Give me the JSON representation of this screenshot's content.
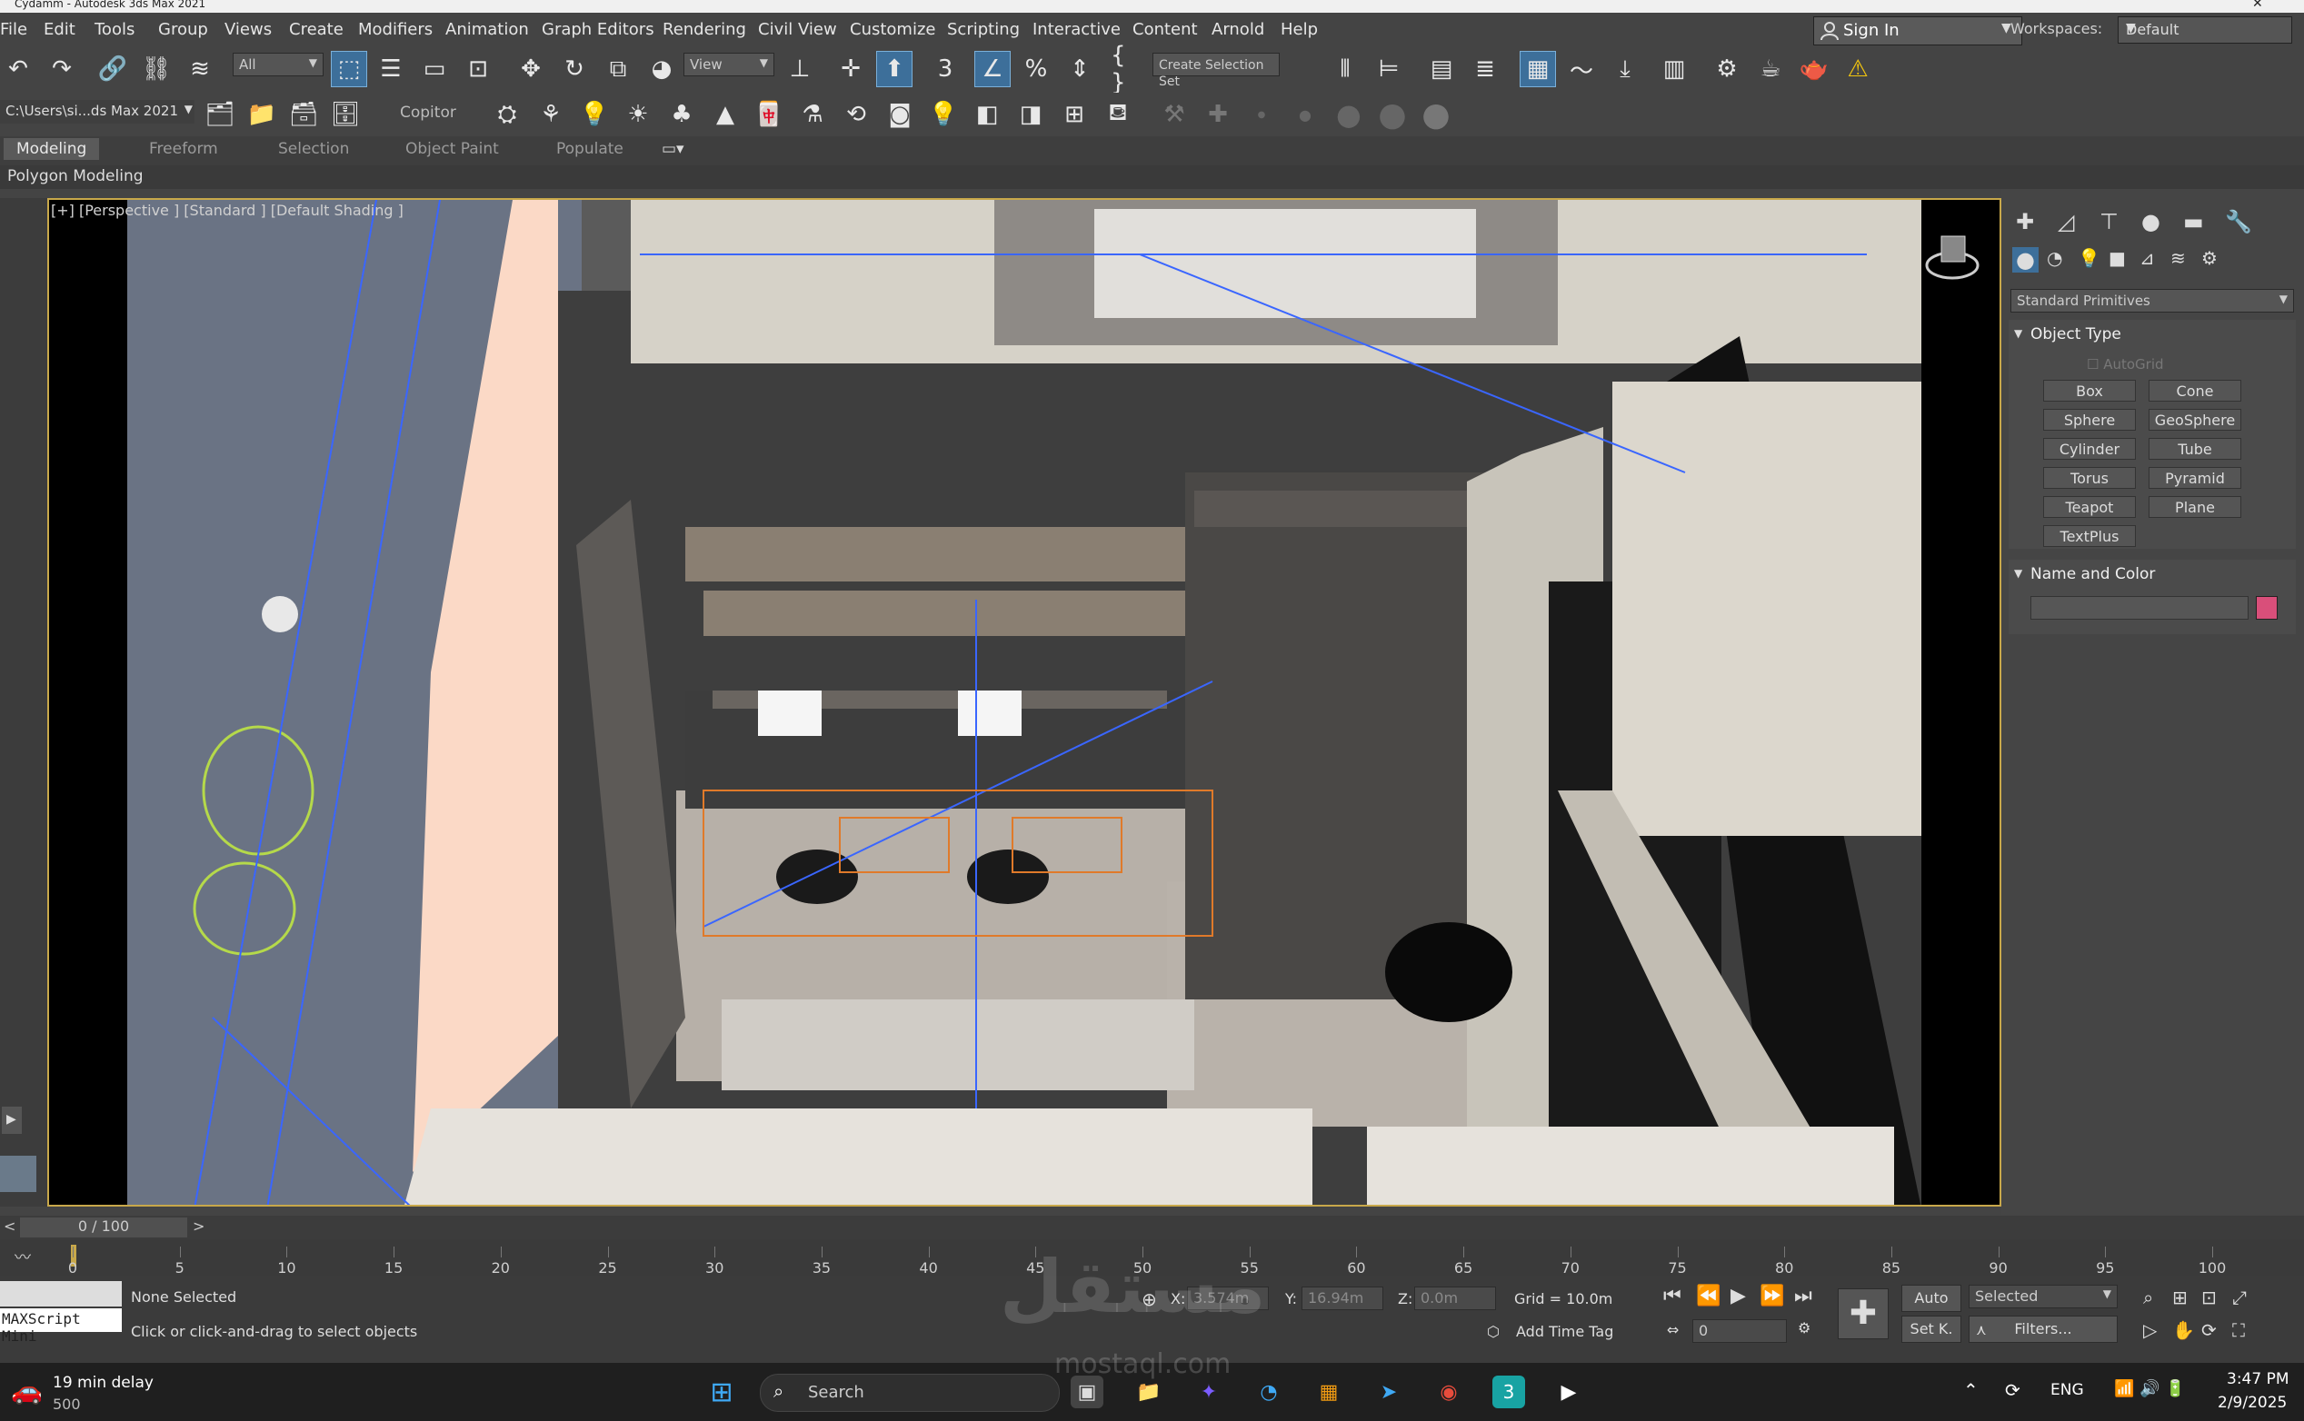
{
  "window": {
    "title": "Cydamm - Autodesk 3ds Max 2021"
  },
  "menu": [
    "File",
    "Edit",
    "Tools",
    "Group",
    "Views",
    "Create",
    "Modifiers",
    "Animation",
    "Graph Editors",
    "Rendering",
    "Civil View",
    "Customize",
    "Scripting",
    "Interactive",
    "Content",
    "Arnold",
    "Help"
  ],
  "account": {
    "signin_label": "Sign In"
  },
  "workspace": {
    "label": "Workspaces:",
    "value": "Default"
  },
  "toolbar": {
    "filter_value": "All",
    "refcoord_value": "View",
    "selection_set_placeholder": "Create Selection Set",
    "project_path": "C:\\Users\\si...ds Max 2021",
    "copitor_label": "Copitor"
  },
  "ribbon": {
    "tabs": [
      "Modeling",
      "Freeform",
      "Selection",
      "Object Paint",
      "Populate"
    ],
    "active_tab": "Modeling",
    "subpanel": "Polygon Modeling"
  },
  "viewport": {
    "label": "[+] [Perspective ] [Standard ] [Default Shading ]"
  },
  "command_panel": {
    "category_value": "Standard Primitives",
    "object_type_title": "Object Type",
    "autogrid_label": "AutoGrid",
    "primitives": [
      "Box",
      "Cone",
      "Sphere",
      "GeoSphere",
      "Cylinder",
      "Tube",
      "Torus",
      "Pyramid",
      "Teapot",
      "Plane",
      "TextPlus"
    ],
    "name_color_title": "Name and Color",
    "object_color": "#d94f7a"
  },
  "time": {
    "slider_label": "0 / 100",
    "ticks": [
      "0",
      "5",
      "10",
      "15",
      "20",
      "25",
      "30",
      "35",
      "40",
      "45",
      "50",
      "55",
      "60",
      "65",
      "70",
      "75",
      "80",
      "85",
      "90",
      "95",
      "100"
    ]
  },
  "status": {
    "selection": "None Selected",
    "prompt": "Click or click-and-drag to select objects",
    "maxscript_label": "MAXScript Mini",
    "x_label": "X:",
    "x_value": "3.574m",
    "y_label": "Y:",
    "y_value": "16.94m",
    "z_label": "Z:",
    "z_value": "0.0m",
    "grid": "Grid = 10.0m",
    "add_time_tag": "Add Time Tag",
    "auto_label": "Auto",
    "selected_value": "Selected",
    "setkey_label": "Set K.",
    "filters_label": "Filters...",
    "frame_value": "0"
  },
  "taskbar": {
    "weather_title": "19 min delay",
    "weather_sub": "500",
    "search_placeholder": "Search",
    "lang": "ENG",
    "time": "3:47 PM",
    "date": "2/9/2025"
  },
  "watermark": {
    "text": "مستقل",
    "url": "mostaql.com"
  }
}
